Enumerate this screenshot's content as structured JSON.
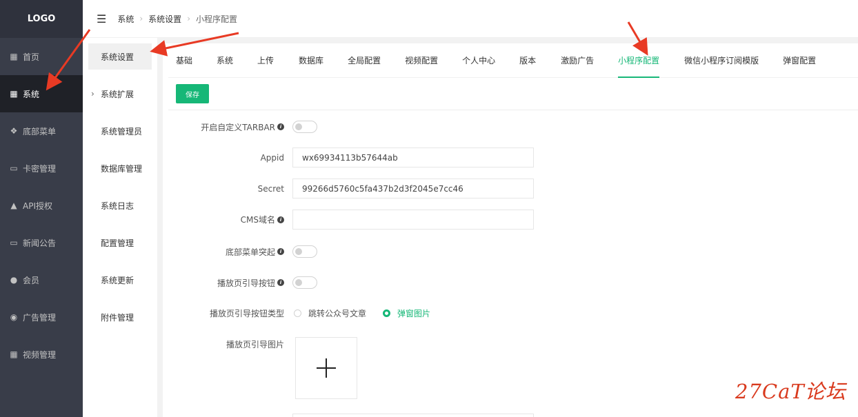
{
  "logo": "LOGO",
  "sidebar": {
    "items": [
      {
        "icon": "grid-icon",
        "label": "首页"
      },
      {
        "icon": "grid-icon",
        "label": "系统"
      },
      {
        "icon": "dropbox-icon",
        "label": "底部菜单"
      },
      {
        "icon": "card-icon",
        "label": "卡密管理"
      },
      {
        "icon": "warning-icon",
        "label": "API授权"
      },
      {
        "icon": "news-icon",
        "label": "新闻公告"
      },
      {
        "icon": "user-icon",
        "label": "会员"
      },
      {
        "icon": "ad-icon",
        "label": "广告管理"
      },
      {
        "icon": "video-grid-icon",
        "label": "视频管理"
      }
    ]
  },
  "breadcrumb": [
    "系统",
    "系统设置",
    "小程序配置"
  ],
  "submenu": {
    "items": [
      "系统设置",
      "系统扩展",
      "系统管理员",
      "数据库管理",
      "系统日志",
      "配置管理",
      "系统更新",
      "附件管理"
    ]
  },
  "tabs": [
    "基础",
    "系统",
    "上传",
    "数据库",
    "全局配置",
    "视频配置",
    "个人中心",
    "版本",
    "激励广告",
    "小程序配置",
    "微信小程序订阅模版",
    "弹窗配置"
  ],
  "active_tab": "小程序配置",
  "toolbar": {
    "save_label": "保存"
  },
  "form": {
    "tarbar_label": "开启自定义TARBAR",
    "appid_label": "Appid",
    "appid_value": "wx69934113b57644ab",
    "secret_label": "Secret",
    "secret_value": "99266d5760c5fa437b2d3f2045e7cc46",
    "cms_label": "CMS域名",
    "cms_value": "",
    "bottom_menu_label": "底部菜单突起",
    "guide_button_label": "播放页引导按钮",
    "guide_type_label": "播放页引导按钮类型",
    "guide_type_options": [
      "跳转公众号文章",
      "弹窗图片"
    ],
    "guide_type_selected": "弹窗图片",
    "guide_image_label": "播放页引导图片"
  },
  "watermark": "27CaT论坛",
  "colors": {
    "accent": "#16b777",
    "sidebar_bg": "#393d49",
    "arrow": "#e83a24"
  }
}
